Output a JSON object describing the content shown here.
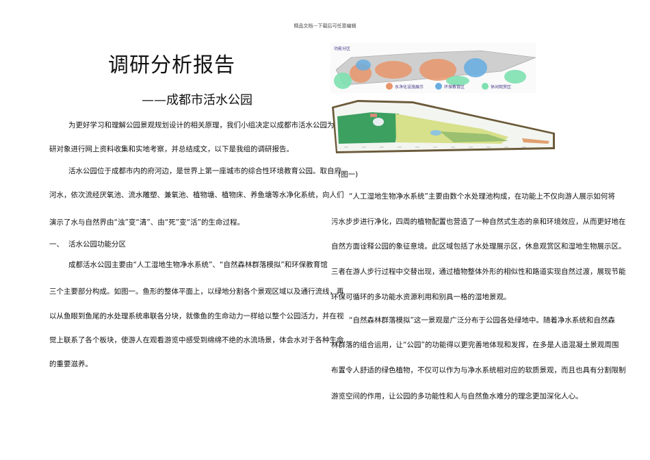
{
  "header": "精品文档---下载后可任意编辑",
  "title": "调研分析报告",
  "subtitle": "——成都市活水公园",
  "left": {
    "p1": [
      "为更好学习和理解公园景观规划设计的相关原理，我们小组决定以成都市活水公园为调",
      "研对象进行网上资料收集和实地考察，并总结成文，以下是我组的调研报告。"
    ],
    "p2": [
      "活水公园位于成都市内的府河边，是世界上第一座城市的综合性环境教育公园。取自府",
      "河水，依次流经厌氧池、流水雕塑、兼氧池、植物塘、植物床、养鱼塘等水净化系统，向人们",
      "演示了水与自然界由“浊”变“清”、由“死”变“活”的生命过程。"
    ],
    "heading_num": "一、",
    "heading": "活水公园功能分区",
    "p3": [
      "成都活水公园主要由“人工湿地生物净水系统”、“自然森林群落模拟”和环保教育馆",
      "三个主要部分构成。如图一。鱼形的整体平面上，以绿地分割各个景观区域以及通行流线，再",
      "以从鱼眼到鱼尾的水处理系统串联各分块，就像鱼的生命动力一样给以整个公园活力，并在视",
      "觉上联系了各个板块，使游人在观看游览中感受到绵绵不绝的水流场景，体会水对于各种生命",
      "的重要滋养。"
    ]
  },
  "figure": {
    "map_title": "功能分区",
    "legend": [
      "水净化设施展示",
      "环保教育区",
      "休闲观赏区"
    ],
    "legend_colors": [
      "#e8956a",
      "#6aaee0",
      "#7ee0b0"
    ],
    "caption": "(图一)"
  },
  "right": {
    "p1": [
      "“人工湿地生物净水系统”主要由数个水处理池构成，在功能上不仅向游人展示如何将",
      "污水步步进行净化，四周的植物配置也营造了一种自然式生态的亲和环境效应，从而更好地在",
      "自然方面诠释公园的象征意境。此区域包括了水处理展示区，休息观赏区和湿地生物展示区。",
      "三者在游人步行过程中交替出现，通过植物整体外形的相似性和路道实现自然过渡，展现节能",
      "环保可循环的多功能水资源利用和别具一格的湿地景观。"
    ],
    "p2": [
      "“自然森林群落模拟”这一景观是广泛分布于公园各处绿地中。随着净水系统和自然森",
      "林群落的组合运用，让“公园”的功能得以更完善地体现和发挥，在多是人造混凝土景观周围",
      "布置令人舒适的绿色植物，不仅可以作为与净水系统相对应的软质景观，而且也具有分割限制",
      "游览空间的作用，让公园的多功能性和人与自然鱼水难分的理念更加深化人心。"
    ]
  }
}
